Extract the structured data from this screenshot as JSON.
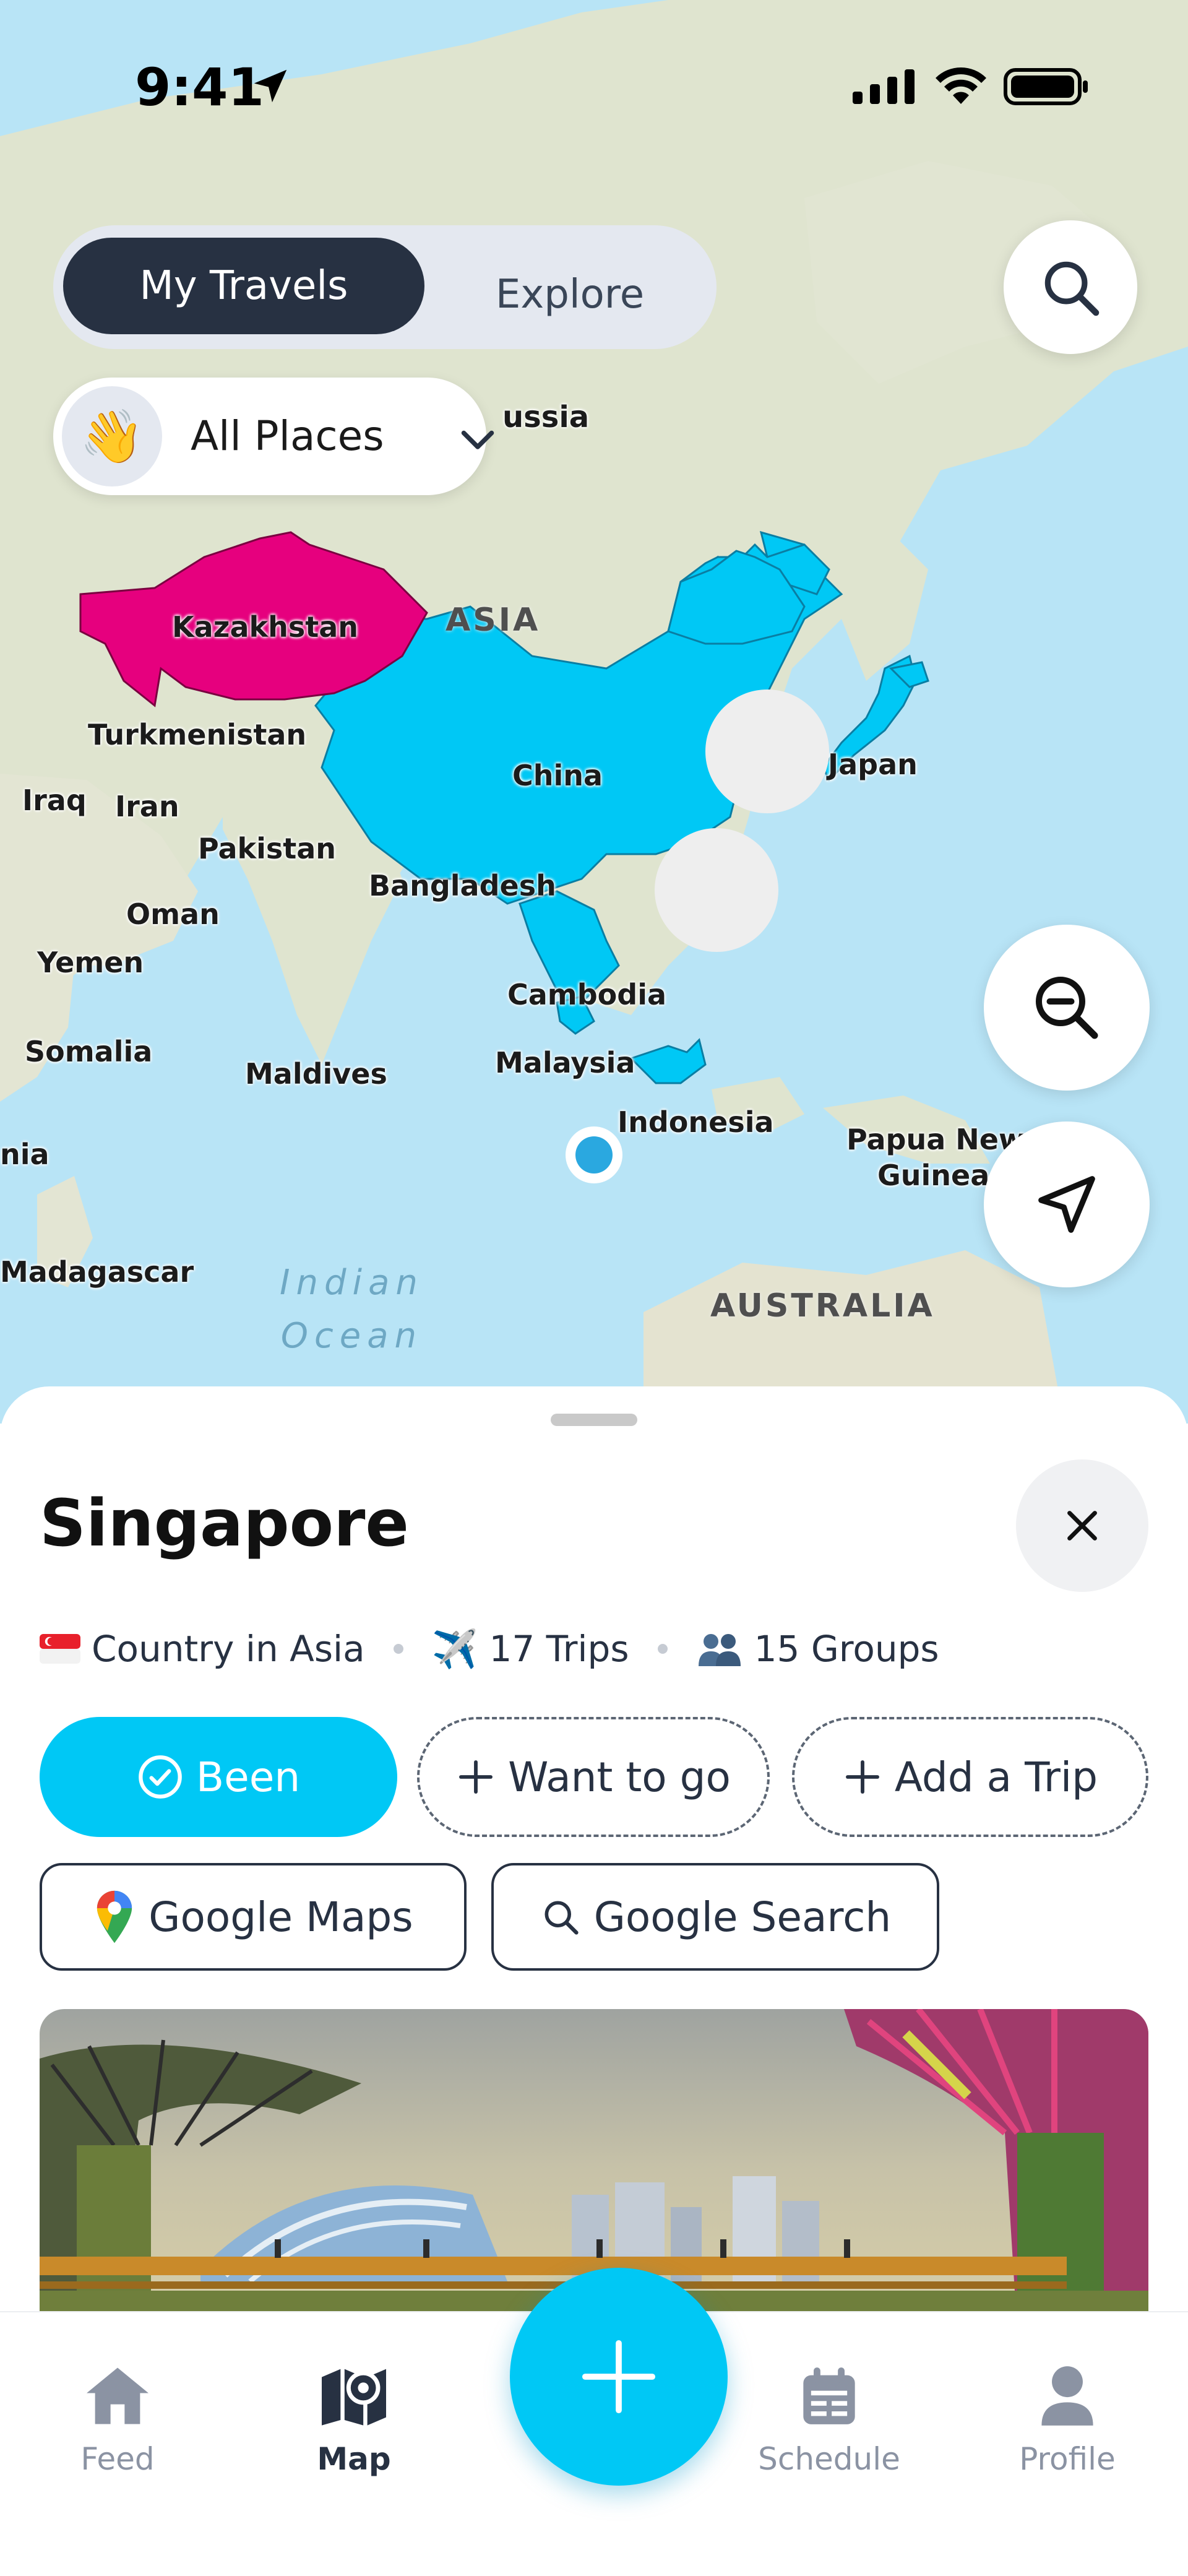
{
  "status_bar": {
    "time": "9:41",
    "icons": [
      "location-arrow-icon",
      "cellular-signal-icon",
      "wifi-icon",
      "battery-icon"
    ]
  },
  "header": {
    "tabs": [
      {
        "label": "My Travels",
        "selected": true
      },
      {
        "label": "Explore",
        "selected": false
      }
    ],
    "search_icon": "search-icon"
  },
  "filter": {
    "emoji": "👋",
    "label": "All Places"
  },
  "map": {
    "labels": {
      "russia": "ussia",
      "asia": "ASIA",
      "kazakhstan": "Kazakhstan",
      "turkmenistan": "Turkmenistan",
      "iraq": "Iraq",
      "iran": "Iran",
      "pakistan": "Pakistan",
      "china": "China",
      "japan": "Japan",
      "oman": "Oman",
      "bangladesh": "Bangladesh",
      "yemen": "Yemen",
      "cambodia": "Cambodia",
      "somalia": "Somalia",
      "maldives": "Maldives",
      "malaysia": "Malaysia",
      "indonesia": "Indonesia",
      "png_1": "Papua New",
      "png_2": "Guinea",
      "nia": "nia",
      "madagascar": "Madagascar",
      "indian_ocean_1": "Indian",
      "indian_ocean_2": "Ocean",
      "australia": "AUSTRALIA"
    },
    "highlight_colors": {
      "visited": "#00c8f5",
      "want_to_go": "#e6007e"
    },
    "controls": [
      "zoom-out-icon",
      "navigate-arrow-icon"
    ]
  },
  "place": {
    "title": "Singapore",
    "close_icon": "close-icon",
    "meta": [
      {
        "emoji": "🇸🇬",
        "text": "Country in Asia"
      },
      {
        "emoji": "✈️",
        "text": "17 Trips"
      },
      {
        "emoji": "👥",
        "text": "15 Groups"
      }
    ],
    "actions": {
      "been": "Been",
      "want_to_go": "Want to go",
      "add_trip": "Add a Trip",
      "google_maps": "Google Maps",
      "google_search": "Google Search"
    }
  },
  "tabbar": {
    "items": [
      {
        "label": "Feed",
        "icon": "home-icon",
        "active": false
      },
      {
        "label": "Map",
        "icon": "map-icon",
        "active": true
      },
      {
        "label": "Schedule",
        "icon": "calendar-icon",
        "active": false
      },
      {
        "label": "Profile",
        "icon": "person-icon",
        "active": false
      }
    ],
    "fab_icon": "plus-icon"
  },
  "colors": {
    "accent": "#00c8f5",
    "dark": "#273142",
    "magenta": "#e6007e"
  }
}
